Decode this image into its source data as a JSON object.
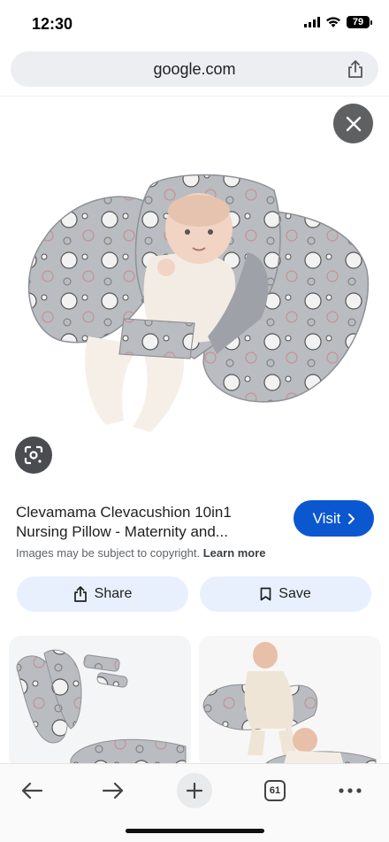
{
  "status": {
    "time": "12:30",
    "battery": "79"
  },
  "browser": {
    "url": "google.com",
    "tab_count": "61"
  },
  "result": {
    "title": "Clevamama Clevacushion 10in1 Nursing Pillow - Maternity and...",
    "visit_label": "Visit",
    "copyright": "Images may be subject to copyright.",
    "learn_more": "Learn more",
    "share_label": "Share",
    "save_label": "Save"
  },
  "icons": {
    "close": "close-icon",
    "lens": "google-lens-icon",
    "share": "share-icon",
    "save": "bookmark-icon",
    "back": "back-arrow-icon",
    "forward": "forward-arrow-icon",
    "new_tab": "plus-icon",
    "more": "more-dots-icon"
  },
  "colors": {
    "accent": "#0b57d0",
    "chip_bg": "#e8f0fe",
    "pillow": "#b9bcc1"
  }
}
